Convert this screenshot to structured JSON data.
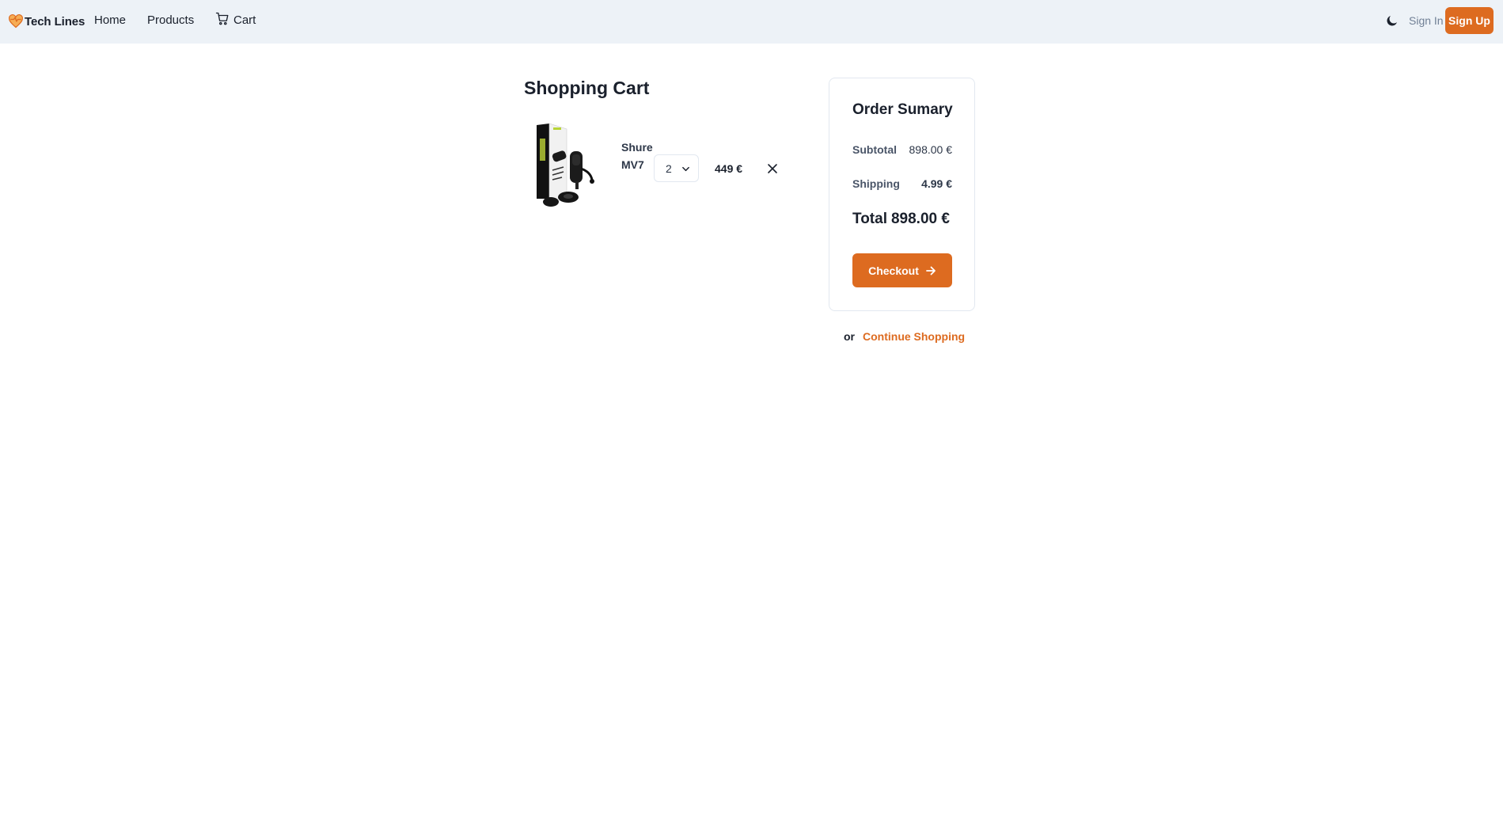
{
  "navbar": {
    "brand": "Tech Lines",
    "links": {
      "home": "Home",
      "products": "Products",
      "cart": "Cart"
    },
    "sign_in": "Sign In",
    "sign_up": "Sign Up"
  },
  "cart": {
    "title": "Shopping Cart",
    "items": [
      {
        "name": "Shure MV7",
        "quantity": "2",
        "price": "449 €"
      }
    ]
  },
  "summary": {
    "title": "Order Sumary",
    "subtotal_label": "Subtotal",
    "subtotal_value": "898.00 €",
    "shipping_label": "Shipping",
    "shipping_value": "4.99 €",
    "total_label": "Total",
    "total_value": "898.00 €",
    "checkout_label": "Checkout"
  },
  "continue": {
    "or": "or",
    "link": "Continue Shopping"
  },
  "colors": {
    "accent": "#dd6b20",
    "navbar_bg": "#edf2f7"
  },
  "icons": [
    "heart-logo-icon",
    "cart-icon",
    "moon-icon",
    "chevron-down-icon",
    "close-icon",
    "arrow-right-icon"
  ]
}
